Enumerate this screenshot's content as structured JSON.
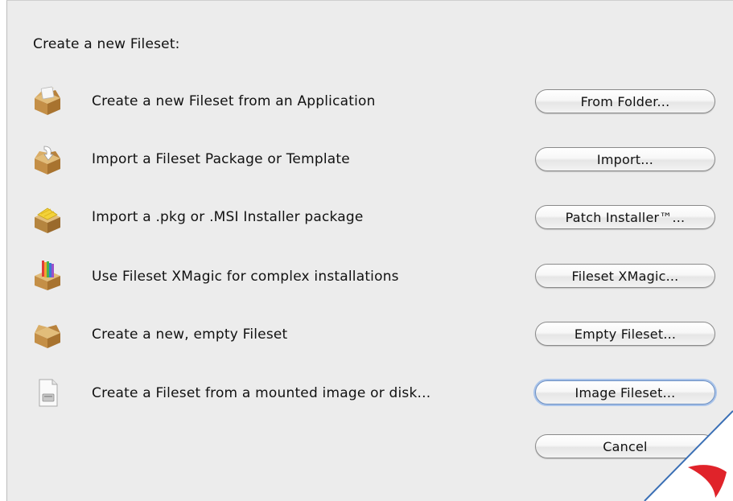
{
  "dialog": {
    "header": "Create a new Fileset:",
    "rows": [
      {
        "label": "Create a new Fileset from an Application",
        "button": "From Folder...",
        "icon": "package-application-icon"
      },
      {
        "label": "Import a Fileset Package or Template",
        "button": "Import...",
        "icon": "package-import-icon"
      },
      {
        "label": "Import a .pkg or .MSI Installer package",
        "button": "Patch Installer™...",
        "icon": "package-installer-icon"
      },
      {
        "label": "Use Fileset XMagic for complex installations",
        "button": "Fileset XMagic...",
        "icon": "package-xmagic-icon"
      },
      {
        "label": "Create a new, empty Fileset",
        "button": "Empty Fileset...",
        "icon": "package-empty-icon"
      },
      {
        "label": "Create a Fileset from a mounted image or disk...",
        "button": "Image Fileset...",
        "icon": "disk-image-icon"
      }
    ],
    "cancel_label": "Cancel"
  },
  "colors": {
    "dialog_bg": "#ececec",
    "box_brown": "#c99a55",
    "corner_red": "#e0232a",
    "focus_ring": "#a8c3ea"
  }
}
